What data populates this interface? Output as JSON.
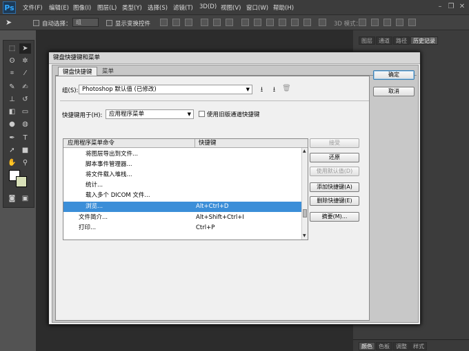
{
  "app": {
    "logo": "Ps",
    "menus": [
      "文件(F)",
      "编辑(E)",
      "图像(I)",
      "图层(L)",
      "类型(Y)",
      "选择(S)",
      "滤镜(T)",
      "3D(D)",
      "视图(V)",
      "窗口(W)",
      "帮助(H)"
    ]
  },
  "options": {
    "auto_select_label": "自动选择：",
    "auto_select_value": "组",
    "show_transform_label": "显示变换控件",
    "mode_3d": "3D 模式："
  },
  "panels": {
    "top_tabs": [
      "图层",
      "通道",
      "路径",
      "历史记录"
    ],
    "bottom_tabs": [
      "颜色",
      "色板",
      "调整",
      "样式"
    ]
  },
  "dialog": {
    "title": "键盘快捷键和菜单",
    "tabs": [
      "键盘快捷键",
      "菜单"
    ],
    "set_label": "组(S):",
    "set_value": "Photoshop 默认值 (已修改)",
    "shortcuts_for_label": "快捷键用于(H):",
    "shortcuts_for_value": "应用程序菜单",
    "legacy_label": "使用旧版通道快捷键",
    "table": {
      "headers": [
        "应用程序菜单命令",
        "快捷键"
      ],
      "rows": [
        {
          "cmd": "将图层导出到文件...",
          "key": "",
          "indent": 2
        },
        {
          "cmd": "脚本事件管理器...",
          "key": "",
          "indent": 2
        },
        {
          "cmd": "将文件载入堆栈...",
          "key": "",
          "indent": 2
        },
        {
          "cmd": "统计...",
          "key": "",
          "indent": 2
        },
        {
          "cmd": "载入多个 DICOM 文件...",
          "key": "",
          "indent": 2
        },
        {
          "cmd": "浏览...",
          "key": "Alt+Ctrl+D",
          "indent": 2,
          "selected": true
        },
        {
          "cmd": "文件简介...",
          "key": "Alt+Shift+Ctrl+I",
          "indent": 1
        },
        {
          "cmd": "打印...",
          "key": "Ctrl+P",
          "indent": 1
        }
      ]
    },
    "buttons": {
      "ok": "确定",
      "cancel": "取消",
      "accept": "接受",
      "undo": "还原",
      "use_default": "使用默认值(D)",
      "add": "添加快捷键(A)",
      "delete": "删除快捷键(E)",
      "summarize": "摘要(M)..."
    }
  }
}
